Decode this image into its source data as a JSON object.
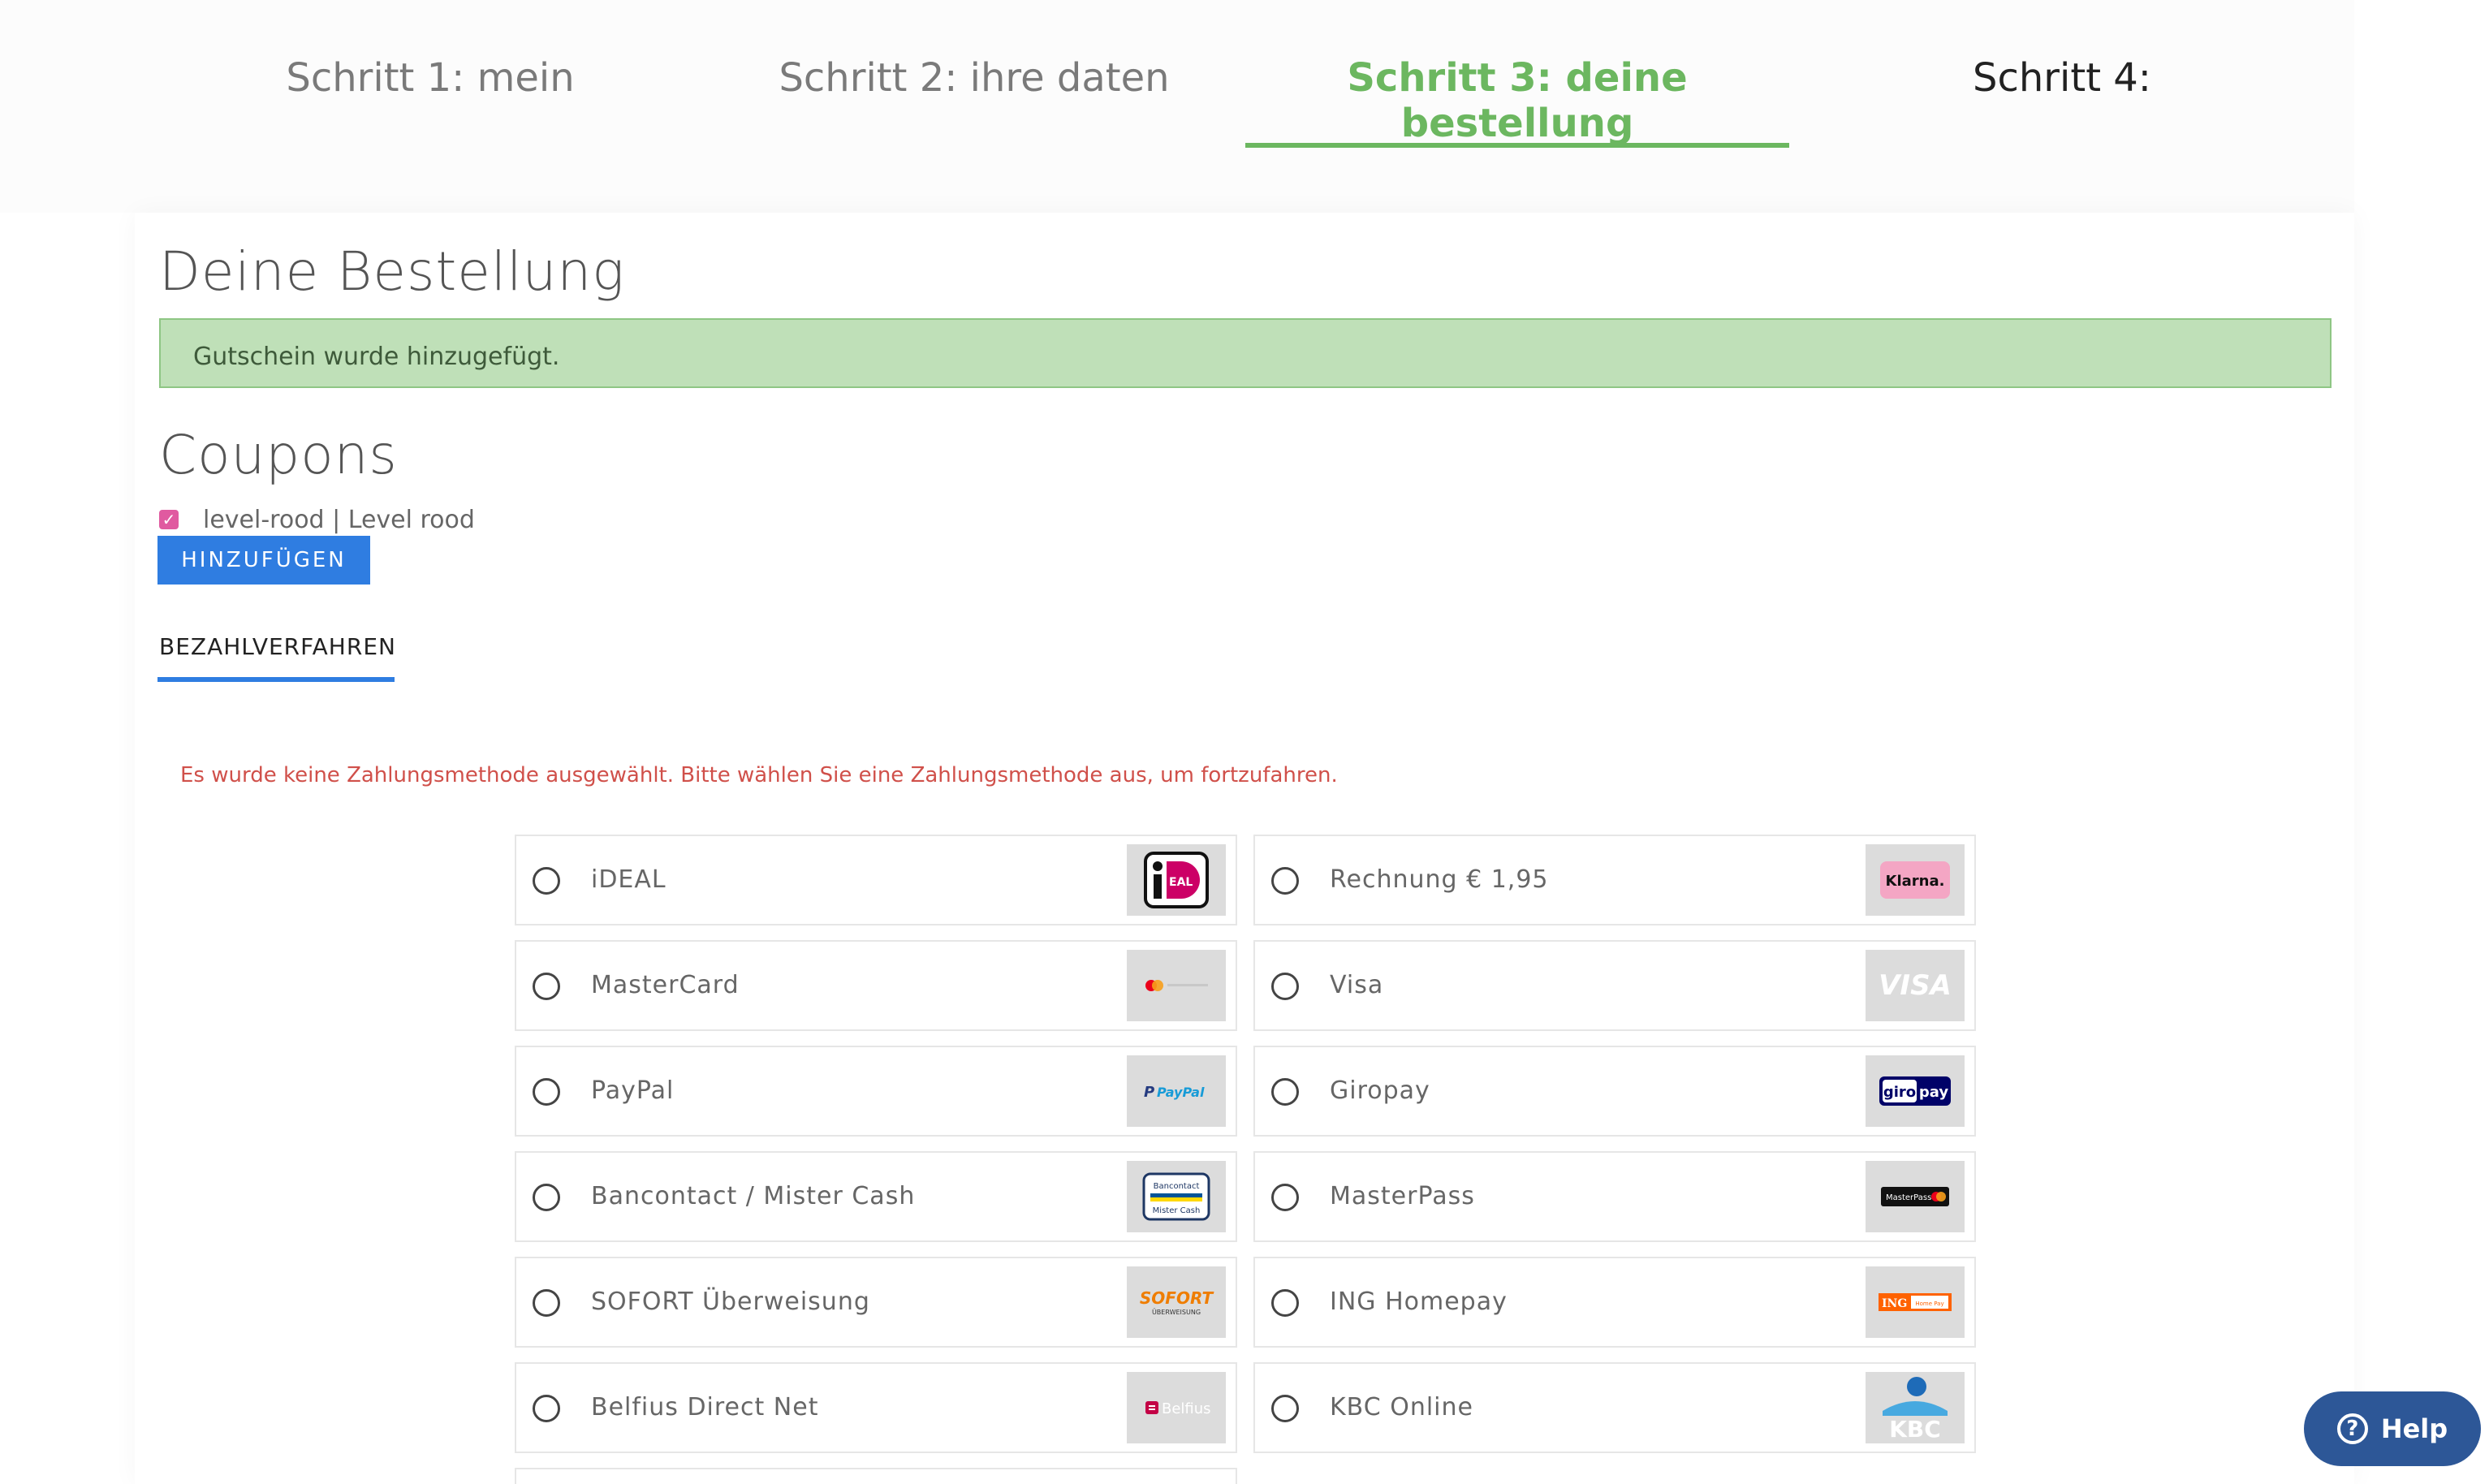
{
  "steps": [
    {
      "label": "Schritt 1: mein"
    },
    {
      "label": "Schritt 2: ihre daten"
    },
    {
      "label": "Schritt 3: deine bestellung"
    },
    {
      "label": "Schritt 4:"
    }
  ],
  "page_title": "Deine Bestellung",
  "alert_message": "Gutschein wurde hinzugefügt.",
  "coupons": {
    "title": "Coupons",
    "item_label": "level-rood | Level rood",
    "checked": true,
    "add_button": "HINZUFÜGEN"
  },
  "payment": {
    "tab_label": "BEZAHLVERFAHREN",
    "error": "Es wurde keine Zahlungsmethode ausgewählt. Bitte wählen Sie eine Zahlungsmethode aus, um fortzufahren.",
    "methods": [
      {
        "label": "iDEAL",
        "icon": "ideal-logo"
      },
      {
        "label": "Rechnung € 1,95",
        "icon": "klarna-logo",
        "logo_text": "Klarna."
      },
      {
        "label": "MasterCard",
        "icon": "mastercard-logo"
      },
      {
        "label": "Visa",
        "icon": "visa-logo",
        "logo_text": "VISA"
      },
      {
        "label": "PayPal",
        "icon": "paypal-logo",
        "logo_text": "PayPal"
      },
      {
        "label": "Giropay",
        "icon": "giropay-logo",
        "logo_text_a": "giro",
        "logo_text_b": "pay"
      },
      {
        "label": "Bancontact / Mister Cash",
        "icon": "bancontact-logo",
        "logo_text_a": "Bancontact",
        "logo_text_b": "Mister Cash"
      },
      {
        "label": "MasterPass",
        "icon": "masterpass-logo",
        "logo_text": "MasterPass"
      },
      {
        "label": "SOFORT Überweisung",
        "icon": "sofort-logo",
        "logo_text_a": "SOFORT",
        "logo_text_b": "ÜBERWEISUNG"
      },
      {
        "label": "ING Homepay",
        "icon": "ing-logo",
        "logo_text_a": "ING",
        "logo_text_b": "Home Pay"
      },
      {
        "label": "Belfius Direct Net",
        "icon": "belfius-logo",
        "logo_text": "Belfius"
      },
      {
        "label": "KBC Online",
        "icon": "kbc-logo",
        "logo_text": "KBC"
      }
    ]
  },
  "help_button": "Help",
  "colors": {
    "active_step": "#6cb760",
    "primary": "#2f7de1",
    "success_bg": "#bfe0b8",
    "error": "#d0504a",
    "help_bg": "#2d5797"
  }
}
